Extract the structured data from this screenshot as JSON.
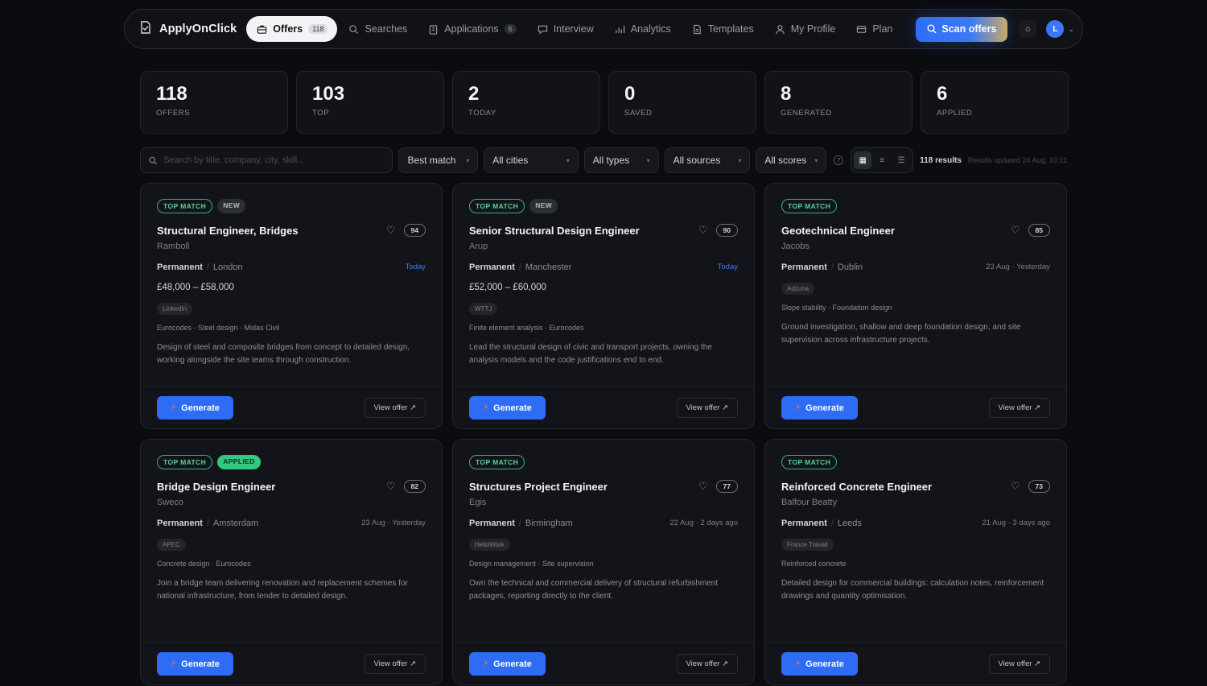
{
  "app": {
    "name": "ApplyOnClick"
  },
  "nav": {
    "items": [
      {
        "label": "Offers",
        "count": "118",
        "icon": "briefcase-icon",
        "active": true
      },
      {
        "label": "Searches",
        "count": "",
        "icon": "search-icon",
        "active": false
      },
      {
        "label": "Applications",
        "count": "6",
        "icon": "clipboard-icon",
        "active": false
      },
      {
        "label": "Interview",
        "count": "",
        "icon": "chat-icon",
        "active": false
      },
      {
        "label": "Analytics",
        "count": "",
        "icon": "bar-chart-icon",
        "active": false
      },
      {
        "label": "Templates",
        "count": "",
        "icon": "document-icon",
        "active": false
      },
      {
        "label": "My Profile",
        "count": "",
        "icon": "user-icon",
        "active": false
      },
      {
        "label": "Plan",
        "count": "",
        "icon": "card-icon",
        "active": false
      }
    ],
    "scan_label": "Scan offers",
    "avatar_initial": "L"
  },
  "stats": [
    {
      "value": "118",
      "label": "OFFERS"
    },
    {
      "value": "103",
      "label": "TOP"
    },
    {
      "value": "2",
      "label": "TODAY"
    },
    {
      "value": "0",
      "label": "SAVED"
    },
    {
      "value": "8",
      "label": "GENERATED"
    },
    {
      "value": "6",
      "label": "APPLIED"
    }
  ],
  "filters": {
    "search_placeholder": "Search by title, company, city, skill...",
    "sort": "Best match",
    "city": "All cities",
    "type": "All types",
    "source": "All sources",
    "score": "All scores",
    "results": "118 results",
    "updated": "Results updated 24 Aug, 10:12"
  },
  "cards": [
    {
      "badges": [
        {
          "label": "TOP MATCH",
          "kind": "top"
        },
        {
          "label": "NEW",
          "kind": "new"
        }
      ],
      "title": "Structural Engineer, Bridges",
      "score": "94",
      "company": "Ramboll",
      "contract": "Permanent",
      "city": "London",
      "date": "Today",
      "today": true,
      "salary": "£48,000 – £58,000",
      "source": "LinkedIn",
      "skills": "Eurocodes · Steel design · Midas Civil",
      "description": "Design of steel and composite bridges from concept to detailed design, working alongside the site teams through construction."
    },
    {
      "badges": [
        {
          "label": "TOP MATCH",
          "kind": "top"
        },
        {
          "label": "NEW",
          "kind": "new"
        }
      ],
      "title": "Senior Structural Design Engineer",
      "score": "90",
      "company": "Arup",
      "contract": "Permanent",
      "city": "Manchester",
      "date": "Today",
      "today": true,
      "salary": "£52,000 – £60,000",
      "source": "WTTJ",
      "skills": "Finite element analysis · Eurocodes",
      "description": "Lead the structural design of civic and transport projects, owning the analysis models and the code justifications end to end."
    },
    {
      "badges": [
        {
          "label": "TOP MATCH",
          "kind": "top"
        }
      ],
      "title": "Geotechnical Engineer",
      "score": "85",
      "company": "Jacobs",
      "contract": "Permanent",
      "city": "Dublin",
      "date": "23 Aug · Yesterday",
      "today": false,
      "salary": "",
      "source": "Adzuna",
      "skills": "Slope stability · Foundation design",
      "description": "Ground investigation, shallow and deep foundation design, and site supervision across infrastructure projects."
    },
    {
      "badges": [
        {
          "label": "TOP MATCH",
          "kind": "top"
        },
        {
          "label": "APPLIED",
          "kind": "applied"
        }
      ],
      "title": "Bridge Design Engineer",
      "score": "82",
      "company": "Sweco",
      "contract": "Permanent",
      "city": "Amsterdam",
      "date": "23 Aug · Yesterday",
      "today": false,
      "salary": "",
      "source": "APEC",
      "skills": "Concrete design · Eurocodes",
      "description": "Join a bridge team delivering renovation and replacement schemes for national infrastructure, from tender to detailed design."
    },
    {
      "badges": [
        {
          "label": "TOP MATCH",
          "kind": "top"
        }
      ],
      "title": "Structures Project Engineer",
      "score": "77",
      "company": "Egis",
      "contract": "Permanent",
      "city": "Birmingham",
      "date": "22 Aug · 2 days ago",
      "today": false,
      "salary": "",
      "source": "HelloWork",
      "skills": "Design management · Site supervision",
      "description": "Own the technical and commercial delivery of structural refurbishment packages, reporting directly to the client."
    },
    {
      "badges": [
        {
          "label": "TOP MATCH",
          "kind": "top"
        }
      ],
      "title": "Reinforced Concrete Engineer",
      "score": "73",
      "company": "Balfour Beatty",
      "contract": "Permanent",
      "city": "Leeds",
      "date": "21 Aug · 3 days ago",
      "today": false,
      "salary": "",
      "source": "France Travail",
      "skills": "Reinforced concrete",
      "description": "Detailed design for commercial buildings: calculation notes, reinforcement drawings and quantity optimisation."
    }
  ],
  "card_actions": {
    "generate": "Generate",
    "view": "View offer ↗"
  },
  "colors": {
    "accent": "#2e6cf6",
    "top_match": "#56d49b",
    "applied": "#34c77f",
    "today": "#3d7cf5"
  }
}
